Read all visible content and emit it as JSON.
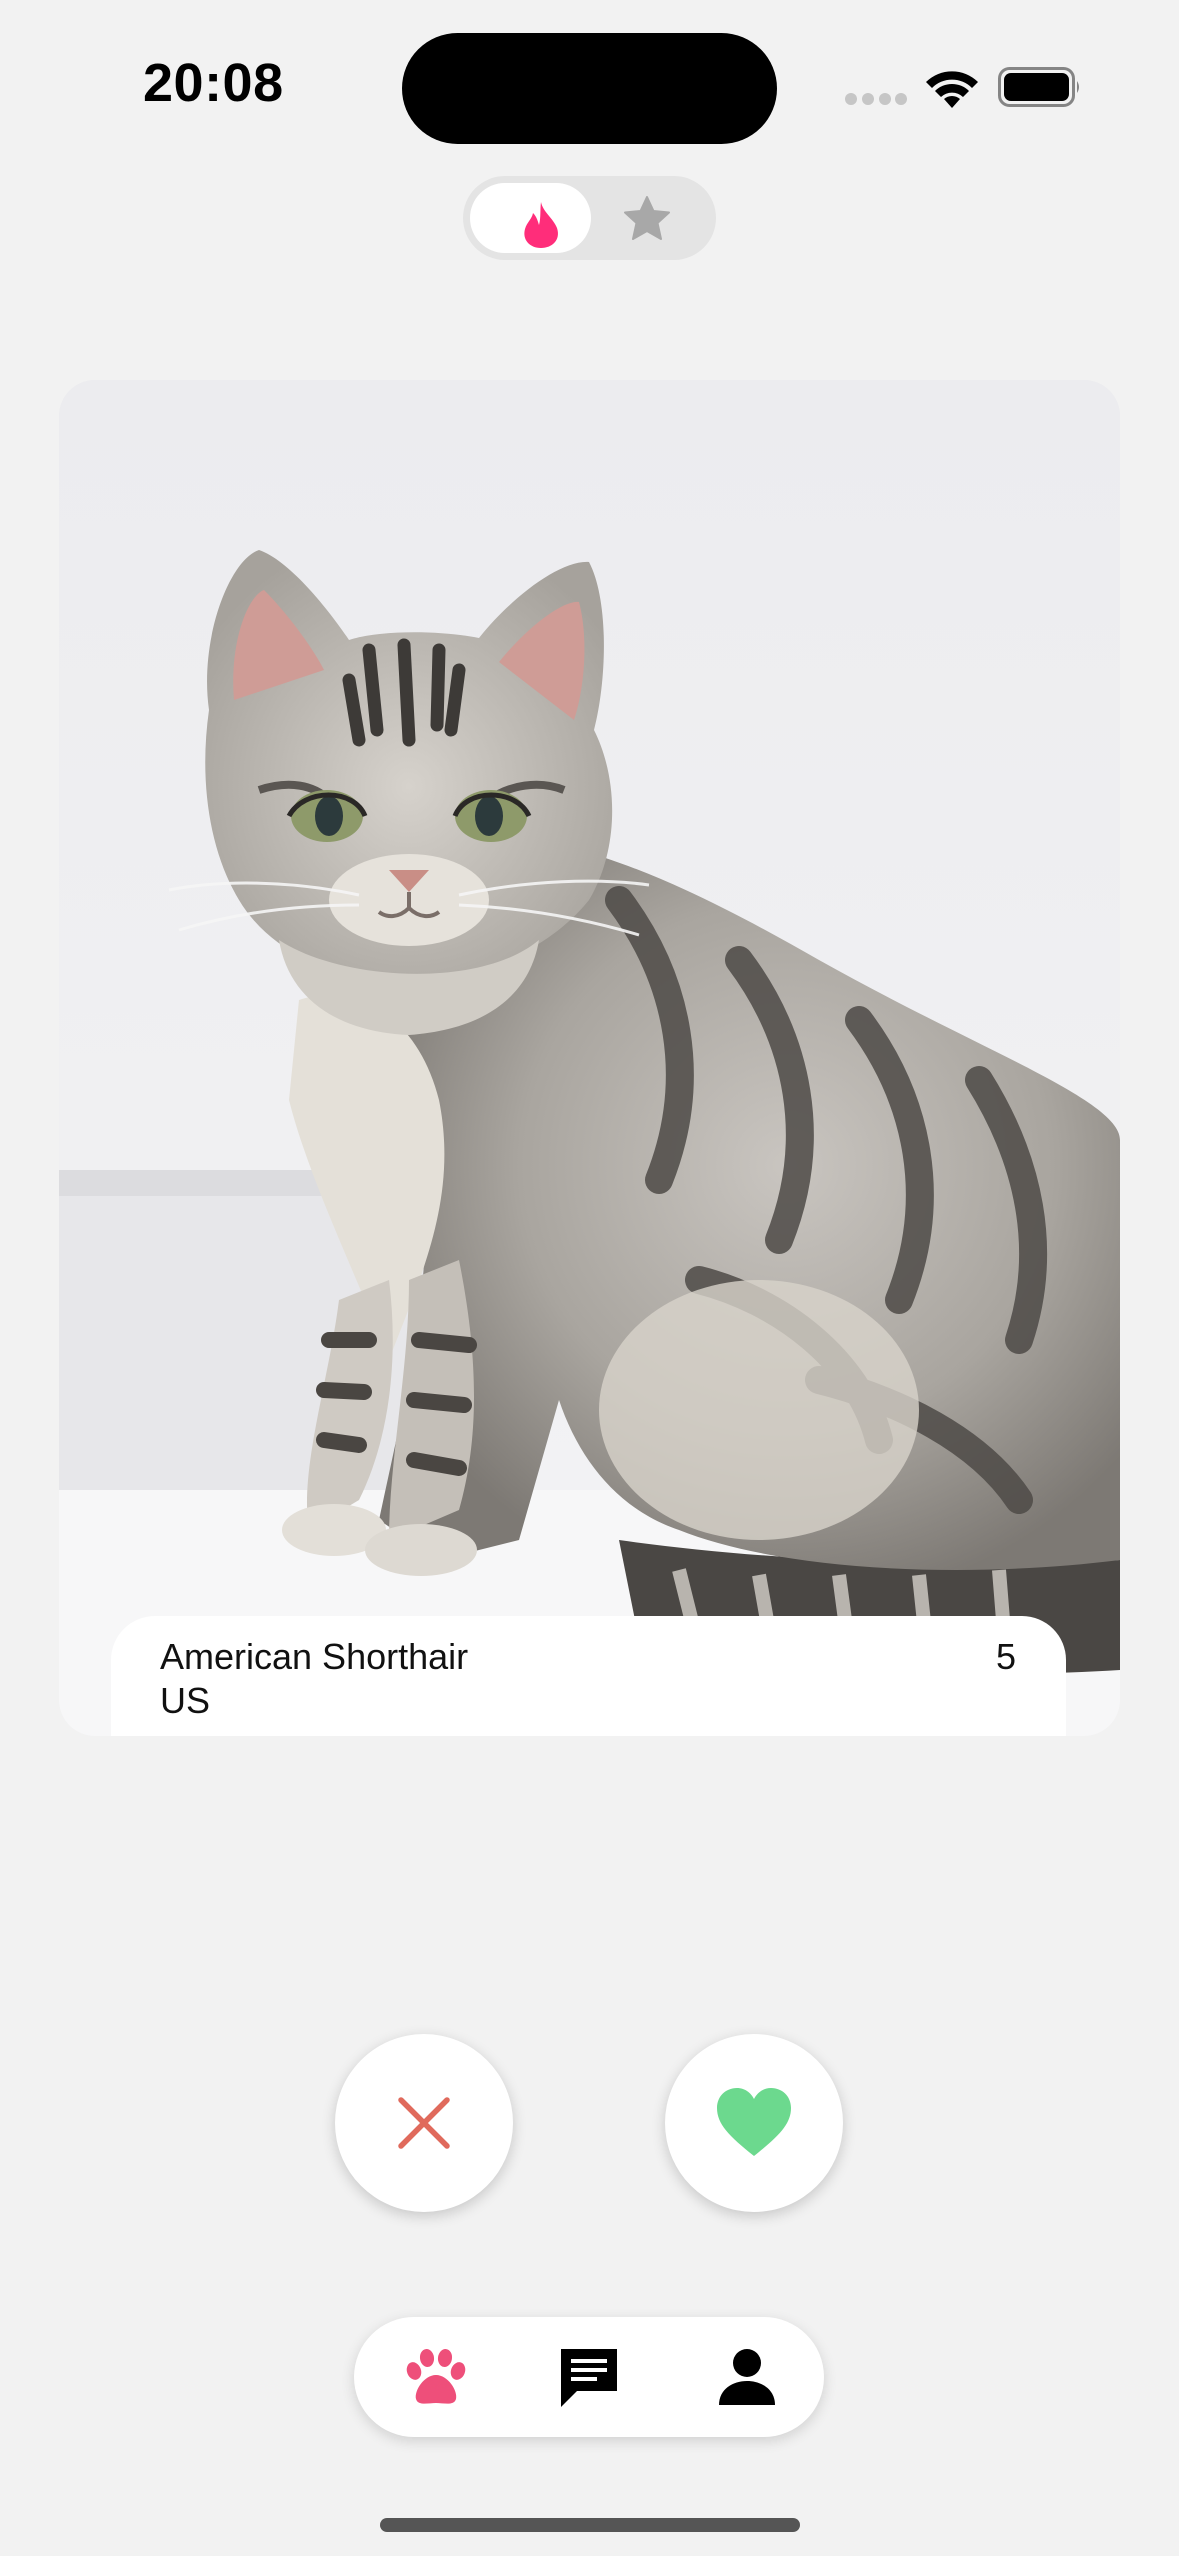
{
  "status_bar": {
    "time": "20:08"
  },
  "mode_toggle": {
    "selected": "flame-icon",
    "options": [
      "flame-icon",
      "star-icon"
    ]
  },
  "card": {
    "breed": "American Shorthair",
    "origin": "US",
    "age": "5",
    "photo_subject": "silver tabby cat"
  },
  "actions": {
    "dislike_icon": "close-icon",
    "like_icon": "heart-icon"
  },
  "tab_bar": {
    "items": [
      "paw-icon",
      "chat-icon",
      "profile-icon"
    ],
    "active": "paw-icon"
  },
  "colors": {
    "accent_pink": "#ff2d7a",
    "paw_pink": "#ee4f7a",
    "dislike_red": "#e06a5c",
    "like_green": "#6cd98e",
    "background": "#f2f2f2"
  }
}
